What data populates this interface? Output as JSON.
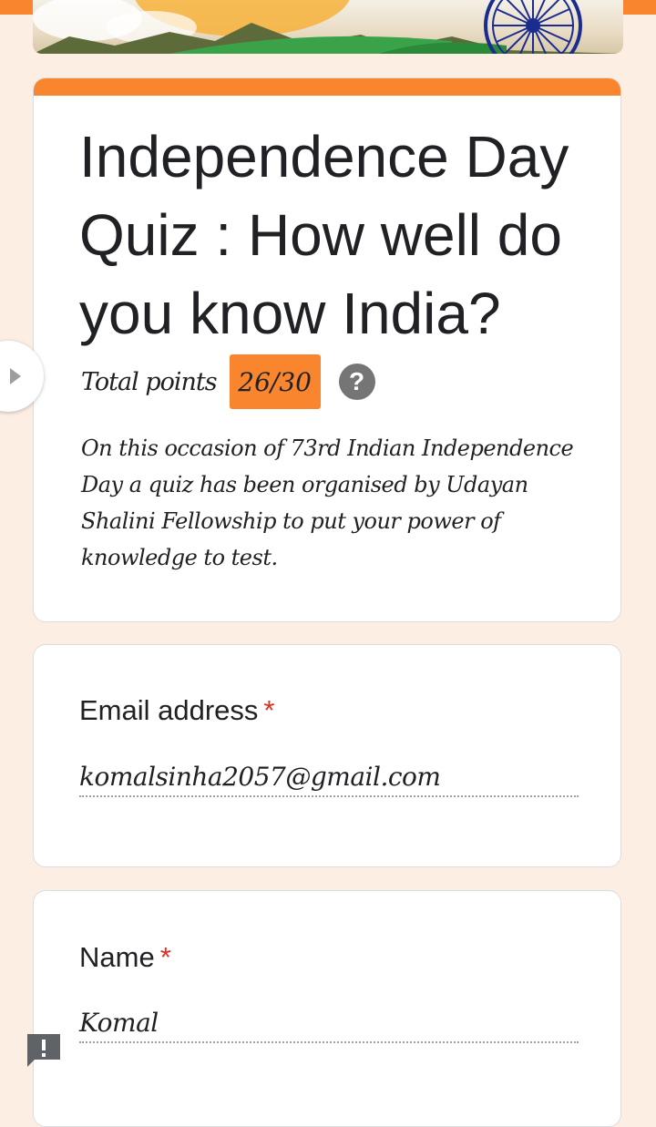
{
  "header": {
    "accent_color": "#f9862e",
    "banner_icon": "ashoka-chakra-icon"
  },
  "form": {
    "title": "Independence Day Quiz : How well do you know India?",
    "total_points_label": "Total points",
    "score": "26/30",
    "help_icon": "?",
    "description": "On this occasion of  73rd Indian Independence Day a quiz has been organised by Udayan Shalini Fellowship to put your power of knowledge to test."
  },
  "questions": [
    {
      "label": "Email address",
      "required": "*",
      "answer": "komalsinha2057@gmail.com"
    },
    {
      "label": "Name",
      "required": "*",
      "answer": "Komal"
    }
  ],
  "side_toggle_icon": "expand-arrow-icon",
  "feedback_icon": "report-problem-icon",
  "colors": {
    "background": "#fdeee4",
    "required": "#d93025",
    "badge": "#f9862e"
  }
}
